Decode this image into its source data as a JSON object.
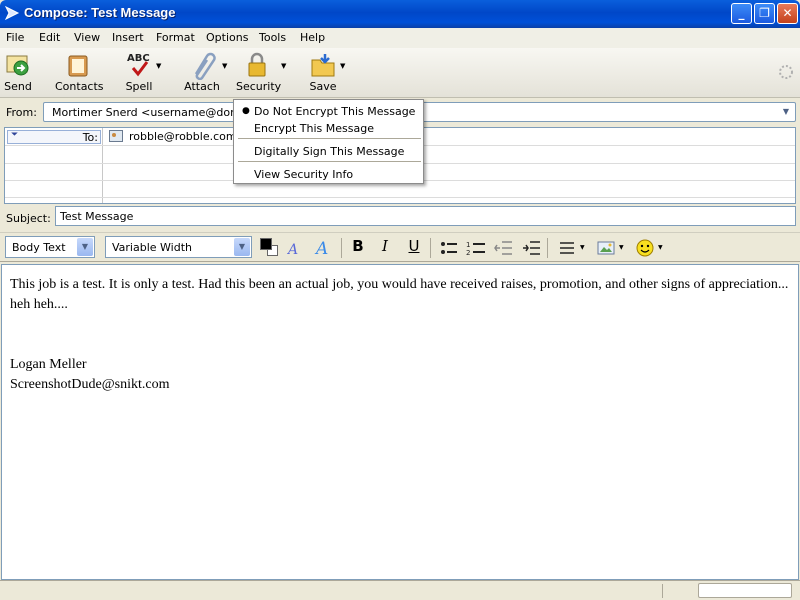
{
  "window": {
    "title": "Compose: Test Message",
    "controls": {
      "minimize": "_",
      "maximize": "❐",
      "close": "✕"
    }
  },
  "menubar": [
    "File",
    "Edit",
    "View",
    "Insert",
    "Format",
    "Options",
    "Tools",
    "Help"
  ],
  "toolbar": {
    "send": "Send",
    "contacts": "Contacts",
    "spell": "Spell",
    "spell_icon_text": "ABC",
    "attach": "Attach",
    "security": "Security",
    "save": "Save"
  },
  "header": {
    "from_label": "From:",
    "from_value": "Mortimer Snerd <username@domain.",
    "to_label": "To:",
    "to_value": "robble@robble.com",
    "subject_label": "Subject:",
    "subject_value": "Test Message"
  },
  "format": {
    "paragraph_style": "Body Text",
    "font": "Variable Width",
    "bold": "B",
    "italic": "I",
    "underline": "U"
  },
  "security_menu": {
    "items": [
      "Do Not Encrypt This Message",
      "Encrypt This Message",
      "Digitally Sign This Message",
      "View Security Info"
    ],
    "selected_index": 0
  },
  "message": {
    "lines": [
      "This job is a test.  It is only a test.  Had this been an actual job, you would have received raises, promotion, and other signs of appreciation... heh heh....",
      "",
      "Logan Meller",
      "ScreenshotDude@snikt.com"
    ]
  },
  "colors": {
    "titlebar": "#0050d8",
    "accent": "#316ac5",
    "text_color_swatch": "#000000"
  },
  "icons": [
    "app-icon",
    "send-icon",
    "contacts-icon",
    "spell-icon",
    "attach-icon",
    "security-lock-icon",
    "save-folder-icon",
    "throbber-icon",
    "contact-card-icon",
    "text-color-icon",
    "smaller-font-icon",
    "larger-font-icon",
    "bulleted-list-icon",
    "numbered-list-icon",
    "outdent-icon",
    "indent-icon",
    "align-icon",
    "insert-image-icon",
    "smiley-icon"
  ]
}
